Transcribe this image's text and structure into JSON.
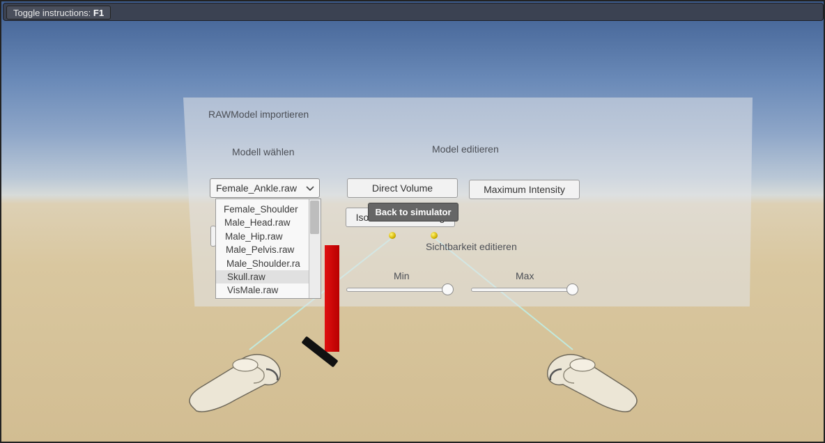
{
  "topbar": {
    "toggle_label": "Toggle instructions:",
    "toggle_key": "F1"
  },
  "panel": {
    "title": "RAWModel importieren",
    "model_choose_label": "Modell wählen",
    "model_edit_label": "Model editieren",
    "dropdown": {
      "selected": "Female_Ankle.raw",
      "options": [
        "Female_Shoulder",
        "Male_Head.raw",
        "Male_Hip.raw",
        "Male_Pelvis.raw",
        "Male_Shoulder.ra",
        "Skull.raw",
        "VisMale.raw"
      ],
      "highlighted_index": 5
    },
    "direct_volume_label": "Direct Volume",
    "max_intensity_label": "Maximum Intensity",
    "isosurface_label": "Isosurface rendering",
    "visibility_label": "Sichtbarkeit editieren",
    "min_label": "Min",
    "max_label": "Max",
    "min_value": 1.0,
    "max_value": 1.0
  },
  "overlay": {
    "back_label": "Back to simulator"
  },
  "icons": {
    "dropdown": "chevron-down-icon",
    "controller": "vr-controller-icon"
  },
  "colors": {
    "accent_red": "#cc0000",
    "laser": "#bfeee6",
    "pointer": "#e6c800"
  }
}
